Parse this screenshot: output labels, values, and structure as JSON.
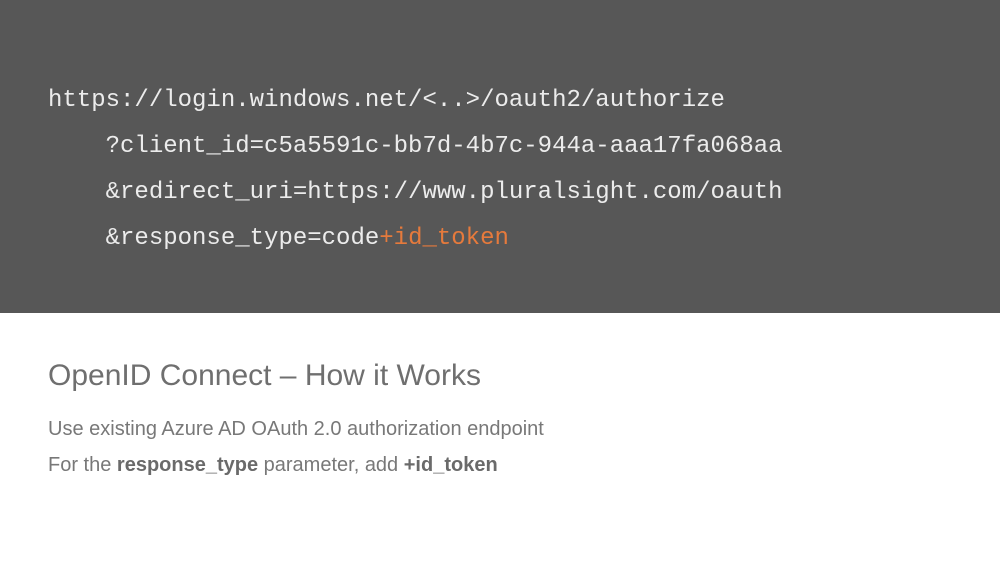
{
  "code": {
    "line1": "https://login.windows.net/<..>/oauth2/authorize",
    "line2": "    ?client_id=c5a5591c-bb7d-4b7c-944a-aaa17fa068aa",
    "line3": "    &redirect_uri=https://www.pluralsight.com/oauth",
    "line4_prefix": "    &response_type=code",
    "line4_highlight": "+id_token"
  },
  "slide": {
    "title": "OpenID Connect – How it Works",
    "sub1": "Use existing Azure AD OAuth 2.0 authorization endpoint",
    "sub2_a": "For the ",
    "sub2_bold1": "response_type",
    "sub2_b": " parameter, add ",
    "sub2_bold2": "+id_token"
  }
}
